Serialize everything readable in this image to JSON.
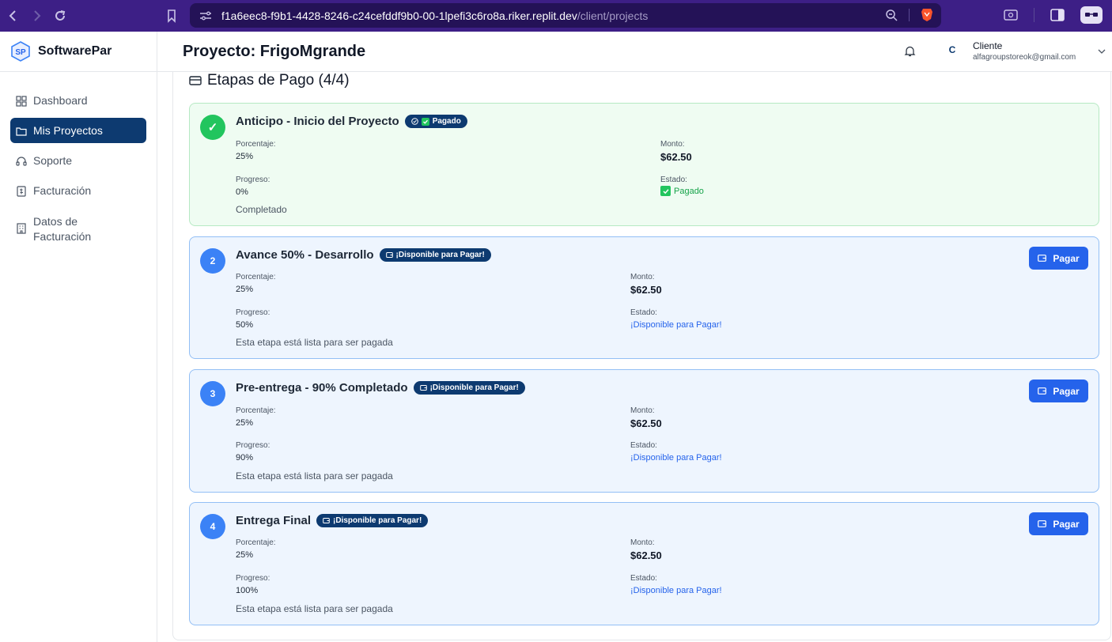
{
  "browser": {
    "url_host": "f1a6eec8-f9b1-4428-8246-c24cefddf9b0-00-1lpefi3c6ro8a.riker.replit.dev",
    "url_path": "/client/projects"
  },
  "sidebar": {
    "brand": "SoftwarePar",
    "items": [
      {
        "label": "Dashboard",
        "icon": "grid-icon"
      },
      {
        "label": "Mis Proyectos",
        "icon": "folder-icon"
      },
      {
        "label": "Soporte",
        "icon": "headset-icon"
      },
      {
        "label": "Facturación",
        "icon": "receipt-icon"
      },
      {
        "label": "Datos de Facturación",
        "icon": "building-icon"
      }
    ]
  },
  "header": {
    "title": "Proyecto: FrigoMgrande",
    "avatar_initial": "C",
    "user_name": "Cliente",
    "user_email": "alfagroupstoreok@gmail.com"
  },
  "section": {
    "title": "Etapas de Pago (4/4)"
  },
  "labels": {
    "porcentaje": "Porcentaje:",
    "monto": "Monto:",
    "progreso": "Progreso:",
    "estado": "Estado:",
    "pay_button": "Pagar"
  },
  "stages": [
    {
      "marker": "✓",
      "title": "Anticipo - Inicio del Proyecto",
      "badge": "Pagado",
      "percentage": "25%",
      "amount": "$62.50",
      "progress": "0%",
      "status": "Pagado",
      "note": "Completado"
    },
    {
      "marker": "2",
      "title": "Avance 50% - Desarrollo",
      "badge": "¡Disponible para Pagar!",
      "percentage": "25%",
      "amount": "$62.50",
      "progress": "50%",
      "status": "¡Disponible para Pagar!",
      "note": "Esta etapa está lista para ser pagada"
    },
    {
      "marker": "3",
      "title": "Pre-entrega - 90% Completado",
      "badge": "¡Disponible para Pagar!",
      "percentage": "25%",
      "amount": "$62.50",
      "progress": "90%",
      "status": "¡Disponible para Pagar!",
      "note": "Esta etapa está lista para ser pagada"
    },
    {
      "marker": "4",
      "title": "Entrega Final",
      "badge": "¡Disponible para Pagar!",
      "percentage": "25%",
      "amount": "$62.50",
      "progress": "100%",
      "status": "¡Disponible para Pagar!",
      "note": "Esta etapa está lista para ser pagada"
    }
  ],
  "colors": {
    "brand_navy": "#0d3a70",
    "pay_blue": "#2563eb",
    "paid_green": "#22c55e",
    "browser_purple": "#3d1f86"
  }
}
